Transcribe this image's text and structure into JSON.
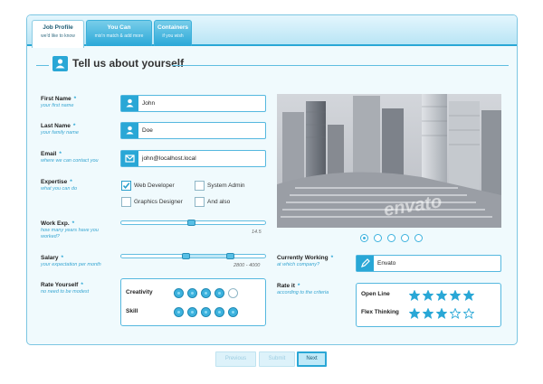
{
  "tabs": [
    {
      "title": "Job Profile",
      "subtitle": "we'd like to know",
      "active": true
    },
    {
      "title": "You Can",
      "subtitle": "mix'n match & add more",
      "active": false
    },
    {
      "title": "Containers",
      "subtitle": "if you wish",
      "active": false
    }
  ],
  "heading": "Tell us about yourself",
  "fields": {
    "first_name": {
      "label": "First Name",
      "hint": "your first name",
      "value": "John"
    },
    "last_name": {
      "label": "Last Name",
      "hint": "your family name",
      "value": "Doe"
    },
    "email": {
      "label": "Email",
      "hint": "where we can contact you",
      "value": "john@localhost.local"
    }
  },
  "expertise": {
    "label": "Expertise",
    "hint": "what you can do",
    "options": [
      {
        "label": "Web Developer",
        "checked": true
      },
      {
        "label": "System Admin",
        "checked": false
      },
      {
        "label": "Graphics Designer",
        "checked": false
      },
      {
        "label": "And also",
        "checked": false
      }
    ]
  },
  "work_exp": {
    "label": "Work Exp.",
    "hint_line1": "how many years have you",
    "hint_line2": "worked?",
    "value_text": "14.5",
    "value": 14.5
  },
  "salary": {
    "label": "Salary",
    "hint": "your expectation per month",
    "value_text": "2800 - 4000",
    "min": 2800,
    "max": 4000
  },
  "rate_yourself": {
    "label": "Rate Yourself",
    "hint": "no need to be modest",
    "items": [
      {
        "label": "Creativity",
        "rating": 4,
        "max": 5
      },
      {
        "label": "Skill",
        "rating": 5,
        "max": 5
      }
    ]
  },
  "currently_working": {
    "label": "Currently Working",
    "hint": "at which company?",
    "value": "Envato"
  },
  "rate_it": {
    "label": "Rate it",
    "hint": "according to the criteria",
    "items": [
      {
        "label": "Open Line",
        "stars": 5,
        "max": 5
      },
      {
        "label": "Flex Thinking",
        "stars": 3,
        "max": 5
      }
    ]
  },
  "image_watermark": "envato",
  "slider_pages": {
    "count": 5,
    "active": 1
  },
  "buttons": {
    "previous": "Previous",
    "submit": "Submit",
    "next": "Next"
  },
  "colors": {
    "accent": "#29a7d6",
    "panel_bg": "#f0fafd",
    "border": "#55b8df"
  }
}
